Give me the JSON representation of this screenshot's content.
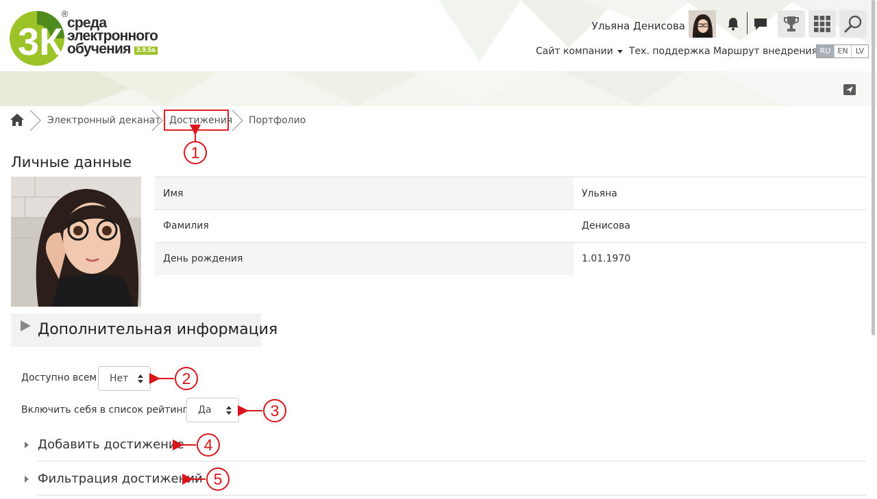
{
  "logo": {
    "reg": "®",
    "line1": "среда",
    "line2": "электронного",
    "line3": "обучения",
    "version": "3.9.5a",
    "mark": "3К"
  },
  "header": {
    "user_name": "Ульяна Денисова",
    "icons": [
      "bell-icon",
      "chat-icon",
      "trophy-icon",
      "apps-grid-icon",
      "search-icon"
    ],
    "nav": {
      "company_site": "Сайт компании",
      "support": "Тех. поддержка",
      "route": "Маршрут внедрения"
    },
    "languages": [
      "RU",
      "EN",
      "LV"
    ],
    "active_language": "RU"
  },
  "breadcrumb": {
    "items": [
      "Электронный деканат",
      "Достижения",
      "Портфолио"
    ]
  },
  "personal": {
    "title": "Личные данные",
    "rows": [
      {
        "label": "Имя",
        "value": "Ульяна"
      },
      {
        "label": "Фамилия",
        "value": "Денисова"
      },
      {
        "label": "День рождения",
        "value": "1.01.1970"
      }
    ]
  },
  "extra_info": "Дополнительная информация",
  "form": {
    "available_label": "Доступно всем",
    "available_value": "Нет",
    "rating_label": "Включить себя в список рейтинга",
    "rating_value": "Да"
  },
  "sections": {
    "add_achievement": "Добавить достижение",
    "filter_achievements": "Фильтрация достижений"
  },
  "annotations": [
    "1",
    "2",
    "3",
    "4",
    "5"
  ],
  "colors": {
    "accent_red": "#d9141b",
    "logo_green": "#9cc428",
    "lang_active": "#a8aeb5"
  }
}
